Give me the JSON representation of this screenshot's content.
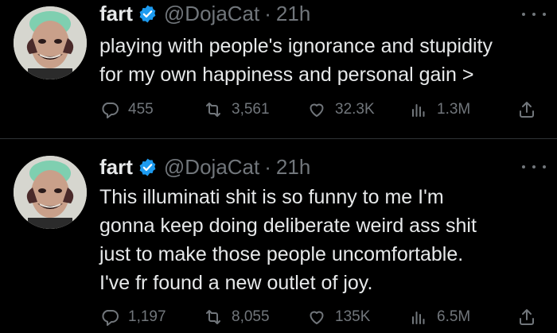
{
  "tweets": [
    {
      "name": "fart",
      "handle": "@DojaCat",
      "separator": "·",
      "time": "21h",
      "lines": [
        "playing with people's ignorance and stupidity",
        "for my own happiness and personal gain >"
      ],
      "replies": "455",
      "retweets": "3,561",
      "likes": "32.3K",
      "views": "1.3M"
    },
    {
      "name": "fart",
      "handle": "@DojaCat",
      "separator": "·",
      "time": "21h",
      "lines": [
        "This illuminati shit is so funny to me I'm",
        "gonna keep doing deliberate weird ass shit",
        "just to make those people uncomfortable.",
        "I've fr found a new outlet of joy."
      ],
      "replies": "1,197",
      "retweets": "8,055",
      "likes": "135K",
      "views": "6.5M"
    }
  ],
  "icons": {
    "reply": "reply-icon",
    "retweet": "retweet-icon",
    "like": "heart-icon",
    "views": "views-icon",
    "share": "share-icon",
    "verified": "verified-badge-icon",
    "more": "more-icon"
  },
  "colors": {
    "background": "#000000",
    "text": "#e7e9ea",
    "secondary": "#71767b",
    "verified": "#1d9bf0"
  }
}
